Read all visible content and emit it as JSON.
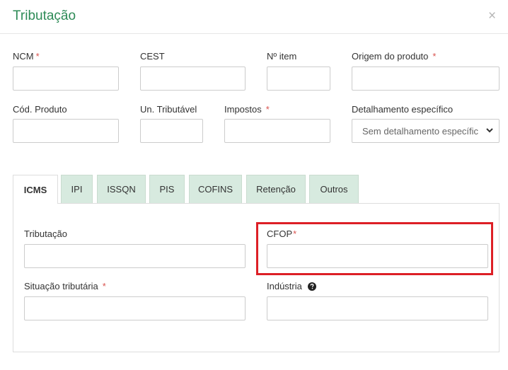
{
  "modal": {
    "title": "Tributação",
    "close_label": "×"
  },
  "fields": {
    "ncm": {
      "label": "NCM",
      "required": "*",
      "value": ""
    },
    "cest": {
      "label": "CEST",
      "value": ""
    },
    "item_number": {
      "label": "Nº item",
      "value": ""
    },
    "origem": {
      "label": "Origem do produto",
      "required": "*",
      "value": ""
    },
    "cod_produto": {
      "label": "Cód. Produto",
      "value": ""
    },
    "un_tributavel": {
      "label": "Un. Tributável",
      "value": ""
    },
    "impostos": {
      "label": "Impostos",
      "required": "*",
      "value": ""
    },
    "detalhamento": {
      "label": "Detalhamento específico",
      "selected": "Sem detalhamento específico"
    }
  },
  "tabs": [
    {
      "label": "ICMS",
      "active": true
    },
    {
      "label": "IPI"
    },
    {
      "label": "ISSQN"
    },
    {
      "label": "PIS"
    },
    {
      "label": "COFINS"
    },
    {
      "label": "Retenção"
    },
    {
      "label": "Outros"
    }
  ],
  "icms": {
    "tributacao": {
      "label": "Tributação",
      "value": ""
    },
    "cfop": {
      "label": "CFOP",
      "required": "*",
      "value": ""
    },
    "situacao": {
      "label": "Situação tributária",
      "required": "*",
      "value": ""
    },
    "industria": {
      "label": "Indústria",
      "value": ""
    }
  },
  "colors": {
    "title": "#2e8b57",
    "tab_bg": "#d7eadf",
    "required": "#d9534f",
    "highlight": "#dd1f26"
  },
  "icons": {
    "close": "close-icon",
    "help": "question-circle-icon",
    "dropdown": "chevron-down-icon"
  }
}
